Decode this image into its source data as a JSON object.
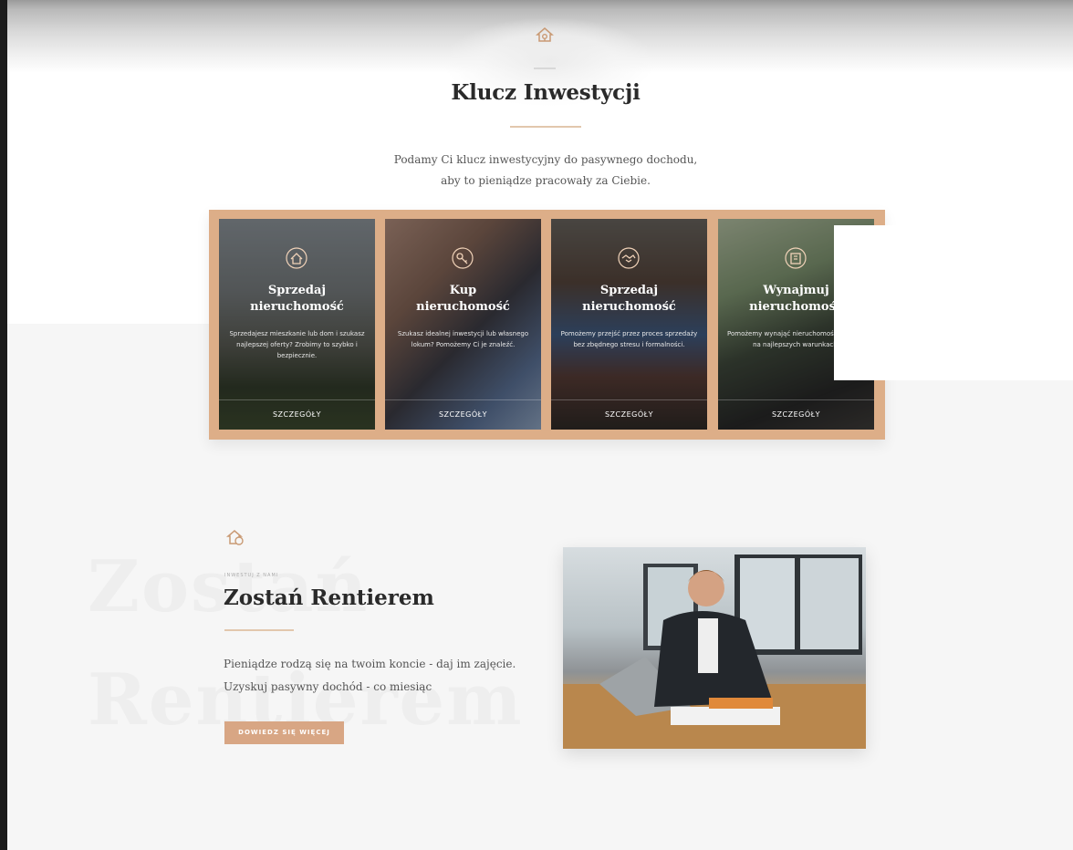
{
  "colors": {
    "accent": "#d8a684",
    "frame": "#ddae88",
    "divider": "#e2c7ad"
  },
  "icons": {
    "section1": "house-key-icon",
    "section2": "house-coin-icon"
  },
  "section1": {
    "title": "Klucz Inwestycji",
    "intro_line1": "Podamy Ci klucz inwestycyjny do pasywnego dochodu,",
    "intro_line2": "aby to pieniądze pracowały za Ciebie."
  },
  "cards": [
    {
      "title_line1": "Sprzedaj",
      "title_line2": "nieruchomość",
      "text": "Sprzedajesz mieszkanie lub dom i szukasz najlepszej oferty? Zrobimy to szybko i bezpiecznie.",
      "link": "SZCZEGÓŁY",
      "icon": "house-icon"
    },
    {
      "title_line1": "Kup",
      "title_line2": "nieruchomość",
      "text": "Szukasz idealnej inwestycji lub własnego lokum? Pomożemy Ci je znaleźć.",
      "link": "SZCZEGÓŁY",
      "icon": "key-icon"
    },
    {
      "title_line1": "Sprzedaj",
      "title_line2": "nieruchomość",
      "text": "Pomożemy przejść przez proces sprzedaży bez zbędnego stresu i formalności.",
      "link": "SZCZEGÓŁY",
      "icon": "handshake-icon"
    },
    {
      "title_line1": "Wynajmuj",
      "title_line2": "nieruchomość",
      "text": "Pomożemy wynająć nieruchomość szybko i na najlepszych warunkach.",
      "link": "SZCZEGÓŁY",
      "icon": "building-icon"
    }
  ],
  "section2": {
    "eyebrow": "INWESTUJ Z NAMI",
    "title": "Zostań Rentierem",
    "watermark_line1": "Zostań",
    "watermark_line2": "Rentierem",
    "para_line1": "Pieniądze rodzą się na twoim koncie - daj im zajęcie.",
    "para_line2": "Uzyskuj pasywny dochód - co miesiąc",
    "cta": "DOWIEDZ SIĘ WIĘCEJ"
  }
}
